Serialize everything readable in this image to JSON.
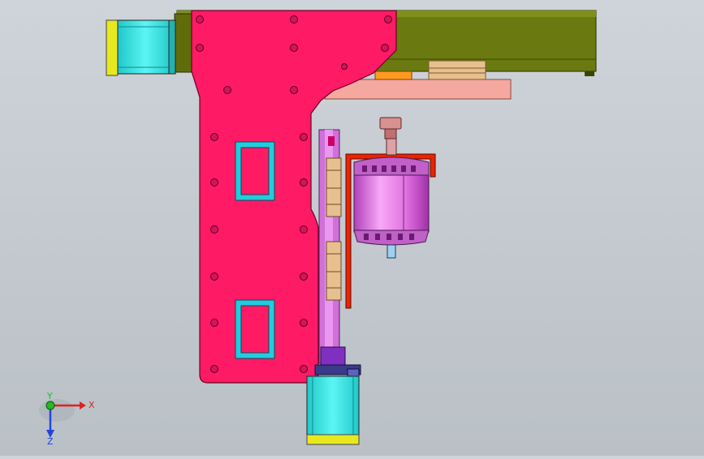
{
  "viewport": {
    "background_top": "#ced4d9",
    "background_bottom": "#b9c0c6"
  },
  "colors": {
    "main_plate": "#ff1a66",
    "beam": "#6b7a10",
    "beam_top": "#7f8f18",
    "stepper_body": "#33e6e6",
    "stepper_cap": "#e0e020",
    "bracket_pink": "#f4a8a0",
    "rail_magenta": "#d070d8",
    "spindle": "#e888e8",
    "spindle_dark": "#9a3aa0",
    "guard_red": "#ee2200",
    "slider_tan": "#e8c090",
    "orange_block": "#ff9a20",
    "coupling_purple": "#8030c0",
    "window_cyan": "#22ccdd"
  },
  "triad": {
    "x_label": "X",
    "y_label": "Y",
    "z_label": "Z",
    "x_color": "#dd2222",
    "y_color": "#22bb22",
    "z_color": "#2244dd"
  },
  "icons": {
    "triad": "xyz-triad-icon"
  }
}
